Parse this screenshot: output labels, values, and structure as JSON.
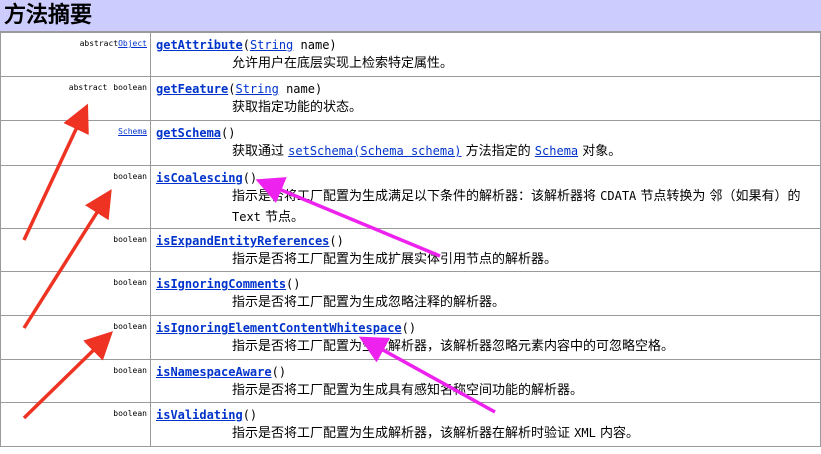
{
  "header": {
    "title": "方法摘要"
  },
  "rows": [
    {
      "modifiers": [
        {
          "text": "abstract",
          "link": false
        },
        {
          "text": "Object",
          "link": true
        }
      ],
      "method": "getAttribute",
      "open": "(",
      "param_type": "String",
      "param_rest": " name)",
      "desc_parts": [
        {
          "text": "允许用户在底层实现上检索特定属性。",
          "kind": "text"
        }
      ]
    },
    {
      "modifiers": [
        {
          "text": "abstract",
          "link": false
        },
        {
          "text": "boolean",
          "link": false
        }
      ],
      "method": "getFeature",
      "open": "(",
      "param_type": "String",
      "param_rest": " name)",
      "desc_parts": [
        {
          "text": "获取指定功能的状态。",
          "kind": "text"
        }
      ]
    },
    {
      "modifiers": [
        {
          "text": "Schema",
          "link": true
        }
      ],
      "method": "getSchema",
      "open": "()",
      "param_type": "",
      "param_rest": "",
      "desc_parts": [
        {
          "text": "获取通过 ",
          "kind": "text"
        },
        {
          "text": "setSchema(Schema schema)",
          "kind": "link"
        },
        {
          "text": " 方法指定的 ",
          "kind": "text"
        },
        {
          "text": "Schema",
          "kind": "link"
        },
        {
          "text": " 对象。",
          "kind": "text"
        }
      ]
    },
    {
      "modifiers": [
        {
          "text": "boolean",
          "link": false
        }
      ],
      "method": "isCoalescing",
      "open": "()",
      "param_type": "",
      "param_rest": "",
      "wrap": true,
      "desc_parts": [
        {
          "text": "指示是否将工厂配置为生成满足以下条件的解析器：该解析器将 ",
          "kind": "text"
        },
        {
          "text": "CDATA",
          "kind": "code"
        },
        {
          "text": " 节点转换为 邻（如果有）的 ",
          "kind": "text"
        },
        {
          "text": "Text",
          "kind": "code"
        },
        {
          "text": " 节点。",
          "kind": "text"
        }
      ]
    },
    {
      "modifiers": [
        {
          "text": "boolean",
          "link": false
        }
      ],
      "method": "isExpandEntityReferences",
      "open": "()",
      "param_type": "",
      "param_rest": "",
      "desc_parts": [
        {
          "text": "指示是否将工厂配置为生成扩展实体引用节点的解析器。",
          "kind": "text"
        }
      ]
    },
    {
      "modifiers": [
        {
          "text": "boolean",
          "link": false
        }
      ],
      "method": "isIgnoringComments",
      "open": "()",
      "param_type": "",
      "param_rest": "",
      "desc_parts": [
        {
          "text": "指示是否将工厂配置为生成忽略注释的解析器。",
          "kind": "text"
        }
      ]
    },
    {
      "modifiers": [
        {
          "text": "boolean",
          "link": false
        }
      ],
      "method": "isIgnoringElementContentWhitespace",
      "open": "()",
      "param_type": "",
      "param_rest": "",
      "desc_parts": [
        {
          "text": "指示是否将工厂配置为生成解析器，该解析器忽略元素内容中的可忽略空格。",
          "kind": "text"
        }
      ]
    },
    {
      "modifiers": [
        {
          "text": "boolean",
          "link": false
        }
      ],
      "method": "isNamespaceAware",
      "open": "()",
      "param_type": "",
      "param_rest": "",
      "desc_parts": [
        {
          "text": "指示是否将工厂配置为生成具有感知名称空间功能的解析器。",
          "kind": "text"
        }
      ]
    },
    {
      "modifiers": [
        {
          "text": "boolean",
          "link": false
        }
      ],
      "method": "isValidating",
      "open": "()",
      "param_type": "",
      "param_rest": "",
      "desc_parts": [
        {
          "text": "指示是否将工厂配置为生成解析器，该解析器在解析时验证 ",
          "kind": "text"
        },
        {
          "text": "XML",
          "kind": "code"
        },
        {
          "text": " 内容。",
          "kind": "text"
        }
      ]
    }
  ],
  "colors": {
    "header_bg": "#ccccff",
    "link": "#0033cc",
    "red_arrow": "#ee3322",
    "magenta_arrow": "#ee22ee"
  }
}
